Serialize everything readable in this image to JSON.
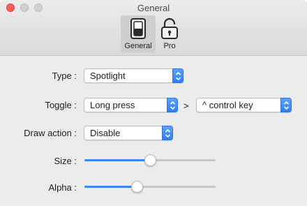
{
  "window": {
    "title": "General"
  },
  "toolbar": {
    "items": [
      {
        "label": "General",
        "icon": "switch-icon",
        "selected": true
      },
      {
        "label": "Pro",
        "icon": "unlocked-padlock-icon",
        "selected": false
      }
    ]
  },
  "form": {
    "type": {
      "label": "Type :",
      "value": "Spotlight"
    },
    "toggle": {
      "label": "Toggle :",
      "value": "Long press",
      "separator": ">",
      "key_value": "^ control key"
    },
    "draw_action": {
      "label": "Draw action :",
      "value": "Disable"
    },
    "size": {
      "label": "Size :",
      "level": 0.5
    },
    "alpha": {
      "label": "Alpha :",
      "level": 0.4
    }
  },
  "colors": {
    "accent": "#3b87f7",
    "close_light": "#ff5f57"
  }
}
